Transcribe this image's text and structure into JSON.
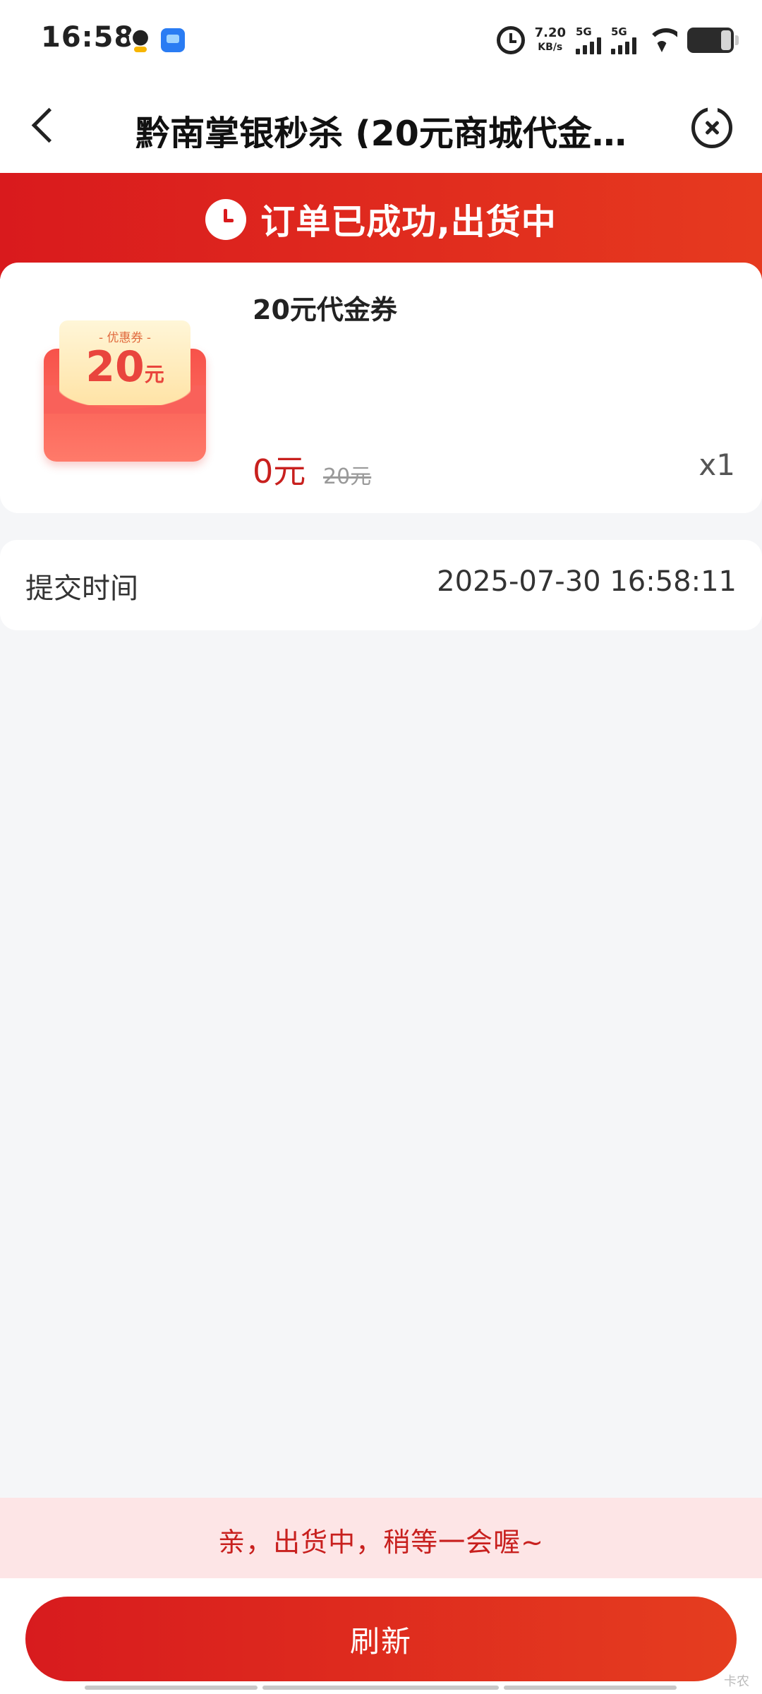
{
  "status_bar": {
    "time": "16:58",
    "net_speed": "7.20",
    "net_speed_unit": "KB/s",
    "sim1_label": "5G",
    "sim2_label": "5G",
    "icons": [
      "qq-icon",
      "message-app-icon",
      "alarm-icon",
      "signal-icon",
      "wifi-icon",
      "battery-icon"
    ]
  },
  "nav": {
    "title": "黔南掌银秒杀 (20元商城代金…",
    "back_icon": "chevron-left-icon",
    "close_icon": "close-circle-icon"
  },
  "banner": {
    "text": "订单已成功,出货中",
    "icon": "clock-icon",
    "color": "#d91a1d"
  },
  "product": {
    "name": "20元代金券",
    "price_current": "0元",
    "price_original": "20元",
    "quantity": "x1",
    "image": {
      "tag": "- 优惠券 -",
      "amount": "20",
      "unit": "元"
    }
  },
  "info": {
    "label": "提交时间",
    "value": "2025-07-30 16:58:11"
  },
  "notice": {
    "text": "亲，出货中，稍等一会喔~"
  },
  "actions": {
    "refresh_label": "刷新"
  },
  "watermark": "卡农"
}
